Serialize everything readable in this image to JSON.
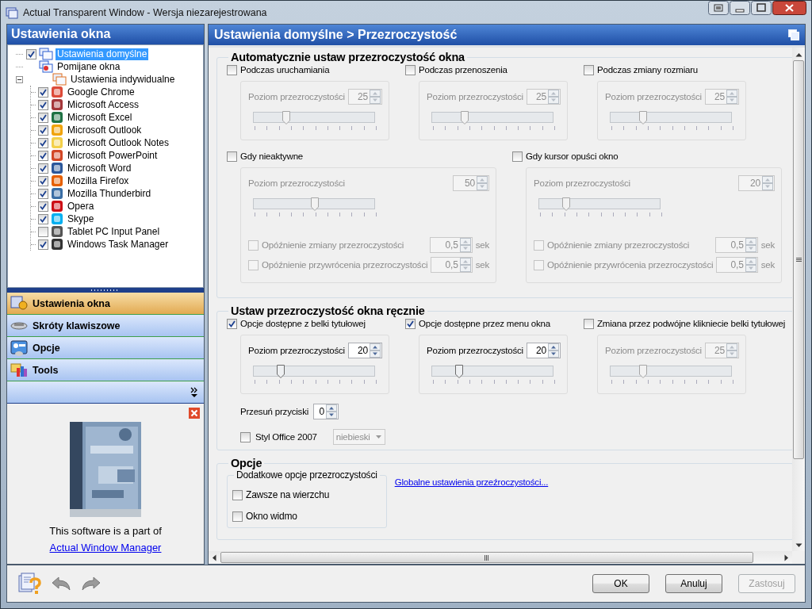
{
  "window": {
    "title": "Actual Transparent Window - Wersja niezarejestrowana"
  },
  "sidebar": {
    "title": "Ustawienia okna",
    "tree": [
      {
        "label": "Ustawienia domyślne",
        "kind": "checkbox",
        "checked": true,
        "selected": true
      },
      {
        "label": "Pomijane okna",
        "kind": "plain",
        "selected": false
      },
      {
        "label": "Ustawienia indywidualne",
        "kind": "plain",
        "selected": false,
        "expanded": true,
        "children": [
          {
            "label": "Google Chrome",
            "kind": "checkbox",
            "checked": true,
            "selected": false
          },
          {
            "label": "Microsoft Access",
            "kind": "checkbox",
            "checked": true,
            "selected": false
          },
          {
            "label": "Microsoft Excel",
            "kind": "checkbox",
            "checked": true,
            "selected": false
          },
          {
            "label": "Microsoft Outlook",
            "kind": "checkbox",
            "checked": true,
            "selected": false
          },
          {
            "label": "Microsoft Outlook Notes",
            "kind": "checkbox",
            "checked": true,
            "selected": false
          },
          {
            "label": "Microsoft PowerPoint",
            "kind": "checkbox",
            "checked": true,
            "selected": false
          },
          {
            "label": "Microsoft Word",
            "kind": "checkbox",
            "checked": true,
            "selected": false
          },
          {
            "label": "Mozilla Firefox",
            "kind": "checkbox",
            "checked": true,
            "selected": false
          },
          {
            "label": "Mozilla Thunderbird",
            "kind": "checkbox",
            "checked": true,
            "selected": false
          },
          {
            "label": "Opera",
            "kind": "checkbox",
            "checked": true,
            "selected": false
          },
          {
            "label": "Skype",
            "kind": "checkbox",
            "checked": true,
            "selected": false
          },
          {
            "label": "Tablet PC Input Panel",
            "kind": "checkbox",
            "checked": false,
            "selected": false
          },
          {
            "label": "Windows Task Manager",
            "kind": "checkbox",
            "checked": true,
            "selected": false
          }
        ]
      }
    ],
    "nav": [
      {
        "label": "Ustawienia okna",
        "selected": true
      },
      {
        "label": "Skróty klawiszowe",
        "selected": false
      },
      {
        "label": "Opcje",
        "selected": false
      },
      {
        "label": "Tools",
        "selected": false
      }
    ],
    "ad": {
      "caption": "This software is a part of",
      "link": "Actual Window Manager"
    }
  },
  "content": {
    "breadcrumb": "Ustawienia domyślne > Przezroczystość",
    "sections": [
      {
        "kind": "groups",
        "title": "Automatycznie ustaw przezroczystość okna",
        "rows": [
          [
            {
              "label": "Podczas uruchamiania",
              "checked": false,
              "level_label": "Poziom przezroczystości",
              "value": "25",
              "level": 0.25
            },
            {
              "label": "Podczas przenoszenia",
              "checked": false,
              "level_label": "Poziom przezroczystości",
              "value": "25",
              "level": 0.25
            },
            {
              "label": "Podczas zmiany rozmiaru",
              "checked": false,
              "level_label": "Poziom przezroczystości",
              "value": "25",
              "level": 0.25
            }
          ],
          [
            {
              "label": "Gdy nieaktywne",
              "checked": false,
              "level_label": "Poziom przezroczystości",
              "value": "50",
              "level": 0.5,
              "delays": [
                {
                  "label": "Opóźnienie zmiany przezroczystości",
                  "checked": false,
                  "value": "0,5",
                  "unit": "sek"
                },
                {
                  "label": "Opóźnienie przywrócenia przezroczystości",
                  "checked": false,
                  "value": "0,5",
                  "unit": "sek"
                }
              ]
            },
            {
              "label": "Gdy kursor opuści okno",
              "checked": false,
              "level_label": "Poziom przezroczystości",
              "value": "20",
              "level": 0.2,
              "delays": [
                {
                  "label": "Opóźnienie zmiany przezroczystości",
                  "checked": false,
                  "value": "0,5",
                  "unit": "sek"
                },
                {
                  "label": "Opóźnienie przywrócenia przezroczystości",
                  "checked": false,
                  "value": "0,5",
                  "unit": "sek"
                }
              ]
            }
          ]
        ]
      },
      {
        "kind": "groups",
        "title": "Ustaw przezroczystość okna ręcznie",
        "rows": [
          [
            {
              "label": "Opcje dostępne z belki tytułowej",
              "checked": true,
              "level_label": "Poziom przezroczystości",
              "value": "20",
              "level": 0.2
            },
            {
              "label": "Opcje dostępne przez menu okna",
              "checked": true,
              "level_label": "Poziom przezroczystości",
              "value": "20",
              "level": 0.2
            },
            {
              "label": "Zmiana przez podwójne klikniecie belki tytułowej",
              "checked": false,
              "level_label": "Poziom przezroczystości",
              "value": "25",
              "level": 0.25
            }
          ]
        ],
        "extras": [
          {
            "kind": "spinner",
            "label": "Przesuń przyciski",
            "value": "0"
          },
          {
            "kind": "checkbox_select",
            "label": "Styl Office 2007",
            "checked": false,
            "value": "niebieski"
          }
        ]
      },
      {
        "kind": "options",
        "title": "Opcje",
        "fieldset": {
          "title": "Dodatkowe opcje przezroczystości",
          "options": [
            {
              "label": "Zawsze na wierzchu",
              "checked": false
            },
            {
              "label": "Okno widmo",
              "checked": false
            }
          ]
        },
        "link": "Globalne ustawienia przeźroczystości..."
      }
    ]
  },
  "footer": {
    "buttons": [
      {
        "label": "OK",
        "disabled": false
      },
      {
        "label": "Anuluj",
        "disabled": false
      },
      {
        "label": "Zastosuj",
        "disabled": true
      }
    ]
  }
}
